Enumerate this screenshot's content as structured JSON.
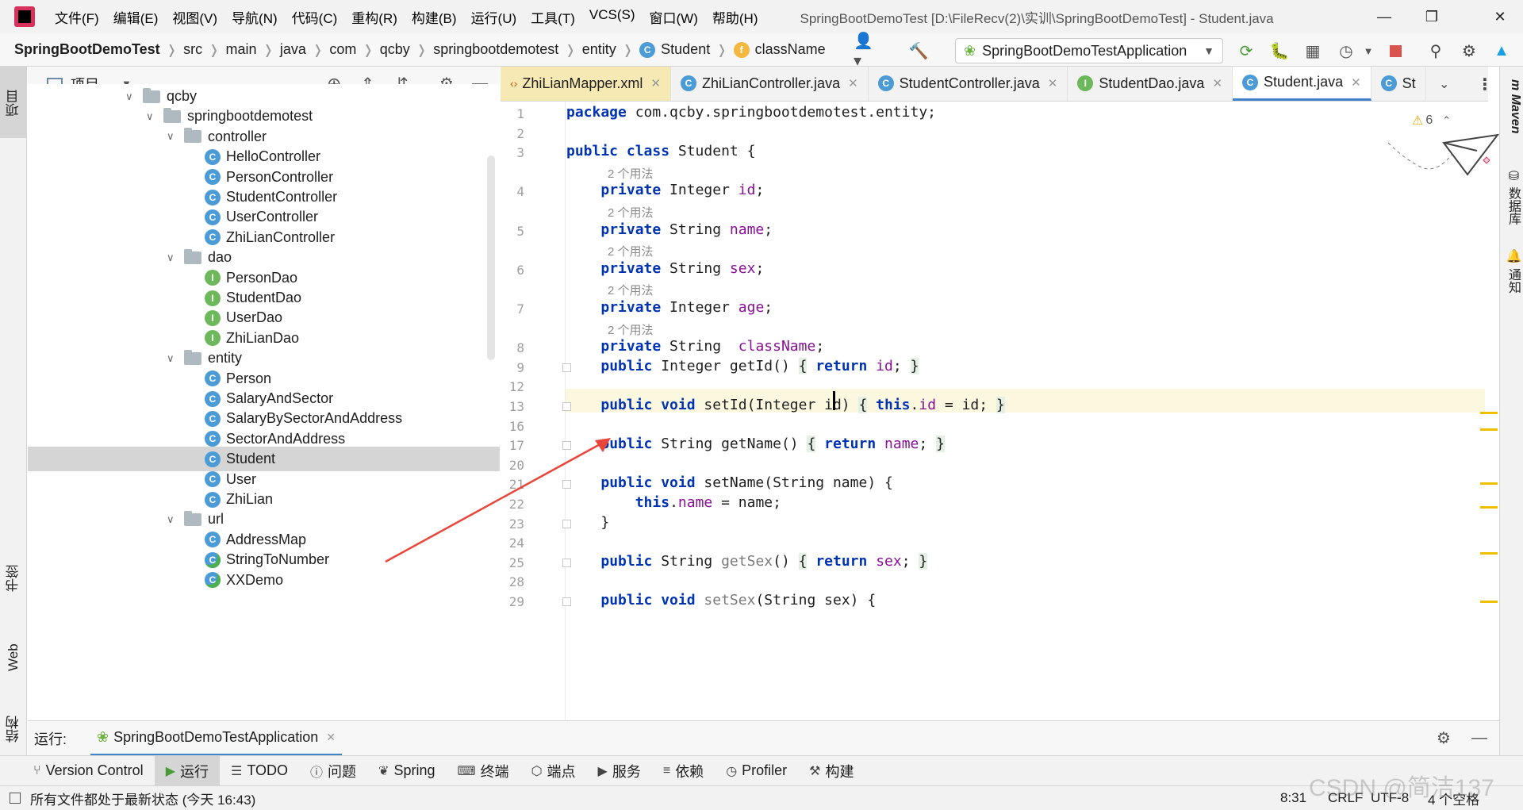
{
  "menubar": {
    "items": [
      "文件(F)",
      "编辑(E)",
      "视图(V)",
      "导航(N)",
      "代码(C)",
      "重构(R)",
      "构建(B)",
      "运行(U)",
      "工具(T)",
      "VCS(S)",
      "窗口(W)",
      "帮助(H)"
    ],
    "window_title": "SpringBootDemoTest [D:\\FileRecv(2)\\实训\\SpringBootDemoTest] - Student.java"
  },
  "breadcrumb": {
    "project": "SpringBootDemoTest",
    "parts": [
      "src",
      "main",
      "java",
      "com",
      "qcby",
      "springbootdemotest",
      "entity"
    ],
    "class": "Student",
    "field": "className"
  },
  "toolbar": {
    "run_config": "SpringBootDemoTestApplication"
  },
  "left_strip": {
    "project": "项目",
    "bookmarks": "书签",
    "web": "Web",
    "structure": "结构"
  },
  "project_panel": {
    "title": "项目"
  },
  "tree": [
    {
      "label": "qcby",
      "type": "folder",
      "level": 0,
      "expanded": true
    },
    {
      "label": "springbootdemotest",
      "type": "folder",
      "level": 1,
      "expanded": true
    },
    {
      "label": "controller",
      "type": "folder",
      "level": 2,
      "expanded": true
    },
    {
      "label": "HelloController",
      "type": "class",
      "level": 3
    },
    {
      "label": "PersonController",
      "type": "class",
      "level": 3
    },
    {
      "label": "StudentController",
      "type": "class",
      "level": 3
    },
    {
      "label": "UserController",
      "type": "class",
      "level": 3
    },
    {
      "label": "ZhiLianController",
      "type": "class",
      "level": 3
    },
    {
      "label": "dao",
      "type": "folder",
      "level": 2,
      "expanded": true
    },
    {
      "label": "PersonDao",
      "type": "interface",
      "level": 3
    },
    {
      "label": "StudentDao",
      "type": "interface",
      "level": 3
    },
    {
      "label": "UserDao",
      "type": "interface",
      "level": 3
    },
    {
      "label": "ZhiLianDao",
      "type": "interface",
      "level": 3
    },
    {
      "label": "entity",
      "type": "folder",
      "level": 2,
      "expanded": true
    },
    {
      "label": "Person",
      "type": "class",
      "level": 3
    },
    {
      "label": "SalaryAndSector",
      "type": "class",
      "level": 3
    },
    {
      "label": "SalaryBySectorAndAddress",
      "type": "class",
      "level": 3
    },
    {
      "label": "SectorAndAddress",
      "type": "class",
      "level": 3
    },
    {
      "label": "Student",
      "type": "class",
      "level": 3,
      "selected": true
    },
    {
      "label": "User",
      "type": "class",
      "level": 3
    },
    {
      "label": "ZhiLian",
      "type": "class",
      "level": 3
    },
    {
      "label": "url",
      "type": "folder",
      "level": 2,
      "expanded": true
    },
    {
      "label": "AddressMap",
      "type": "class",
      "level": 3
    },
    {
      "label": "StringToNumber",
      "type": "runnable",
      "level": 3
    },
    {
      "label": "XXDemo",
      "type": "runnable",
      "level": 3
    }
  ],
  "tabs": [
    {
      "label": "ZhiLianMapper.xml",
      "kind": "xml"
    },
    {
      "label": "ZhiLianController.java",
      "kind": "class"
    },
    {
      "label": "StudentController.java",
      "kind": "class"
    },
    {
      "label": "StudentDao.java",
      "kind": "interface"
    },
    {
      "label": "Student.java",
      "kind": "class",
      "active": true
    },
    {
      "label": "St",
      "kind": "runnable"
    }
  ],
  "editor": {
    "warning_count": "6",
    "lines": [
      {
        "n": "1",
        "html": "<span class='kw'>package</span> com.qcby.springbootdemotest.entity;"
      },
      {
        "n": "2",
        "html": ""
      },
      {
        "n": "3",
        "html": "<span class='kw'>public class</span> Student {"
      },
      {
        "n": "",
        "hint": "2 个用法"
      },
      {
        "n": "4",
        "html": "    <span class='kw'>private</span> Integer <span class='fld'>id</span>;"
      },
      {
        "n": "",
        "hint": "2 个用法"
      },
      {
        "n": "5",
        "html": "    <span class='kw'>private</span> String <span class='fld'>name</span>;"
      },
      {
        "n": "",
        "hint": "2 个用法"
      },
      {
        "n": "6",
        "html": "    <span class='kw'>private</span> String <span class='fld'>sex</span>;"
      },
      {
        "n": "",
        "hint": "2 个用法"
      },
      {
        "n": "7",
        "html": "    <span class='kw'>private</span> Integer <span class='fld'>age</span>;"
      },
      {
        "n": "",
        "hint": "2 个用法"
      },
      {
        "n": "8",
        "html": "    <span class='kw'>private</span> String  <span class='fld'>className</span>;"
      },
      {
        "n": "9",
        "html": "    <span class='kw'>public</span> Integer getId() <span class='bracehl'>{</span> <span class='kw'>return</span> <span class='fld'>id</span>; <span class='bracehl'>}</span>",
        "fold": true
      },
      {
        "n": "12",
        "html": ""
      },
      {
        "n": "13",
        "html": "    <span class='kw'>public void</span> setId(Integer id) <span class='bracehl'>{</span> <span class='kw'>this</span>.<span class='fld'>id</span> = id; <span class='bracehl'>}</span>",
        "fold": true
      },
      {
        "n": "16",
        "html": ""
      },
      {
        "n": "17",
        "html": "    <span class='kw'>public</span> String getName() <span class='bracehl'>{</span> <span class='kw'>return</span> <span class='fld'>name</span>; <span class='bracehl'>}</span>",
        "fold": true
      },
      {
        "n": "20",
        "html": ""
      },
      {
        "n": "21",
        "html": "    <span class='kw'>public void</span> setName(String name) {",
        "fold": true
      },
      {
        "n": "22",
        "html": "        <span class='kw'>this</span>.<span class='fld'>name</span> = name;"
      },
      {
        "n": "23",
        "html": "    }",
        "fold": true
      },
      {
        "n": "24",
        "html": ""
      },
      {
        "n": "25",
        "html": "    <span class='kw'>public</span> String <span style='color:#7a7a7a'>getSex</span>() <span class='bracehl'>{</span> <span class='kw'>return</span> <span class='fld'>sex</span>; <span class='bracehl'>}</span>",
        "fold": true
      },
      {
        "n": "28",
        "html": ""
      },
      {
        "n": "29",
        "html": "    <span class='kw'>public void</span> <span style='color:#7a7a7a'>setSex</span>(String sex) {",
        "fold": true
      }
    ]
  },
  "right_strip": {
    "maven": "Maven",
    "database": "数据库",
    "notifications": "通知"
  },
  "run_bar": {
    "label": "运行:",
    "config": "SpringBootDemoTestApplication"
  },
  "tool_windows": [
    {
      "label": "Version Control",
      "icon": "branch-icon"
    },
    {
      "label": "运行",
      "icon": "run-icon",
      "active": true
    },
    {
      "label": "TODO",
      "icon": "list-icon"
    },
    {
      "label": "问题",
      "icon": "problems-icon"
    },
    {
      "label": "Spring",
      "icon": "spring-icon"
    },
    {
      "label": "终端",
      "icon": "terminal-icon"
    },
    {
      "label": "端点",
      "icon": "endpoints-icon"
    },
    {
      "label": "服务",
      "icon": "services-icon"
    },
    {
      "label": "依赖",
      "icon": "dependencies-icon"
    },
    {
      "label": "Profiler",
      "icon": "profiler-icon"
    },
    {
      "label": "构建",
      "icon": "build-icon"
    }
  ],
  "status": {
    "message": "所有文件都处于最新状态 (今天 16:43)",
    "position": "8:31",
    "line_sep": "CRLF",
    "encoding": "UTF-8",
    "indent": "4 个空格",
    "watermark": "CSDN @简洁137"
  }
}
